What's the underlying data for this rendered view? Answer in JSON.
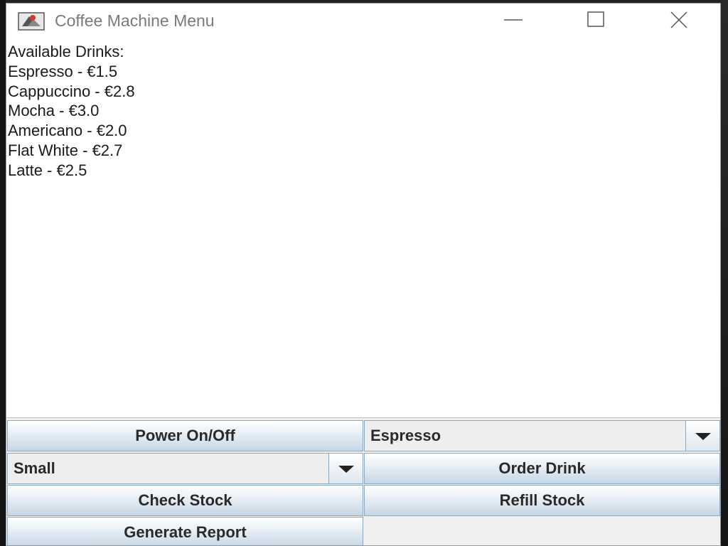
{
  "window": {
    "title": "Coffee Machine Menu"
  },
  "menu_text": {
    "heading": "Available Drinks:",
    "items": [
      "Espresso - €1.5",
      "Cappuccino - €2.8",
      "Mocha - €3.0",
      "Americano - €2.0",
      "Flat White - €2.7",
      "Latte - €2.5"
    ]
  },
  "controls": {
    "power_label": "Power On/Off",
    "drink_select_value": "Espresso",
    "size_select_value": "Small",
    "order_label": "Order Drink",
    "check_stock_label": "Check Stock",
    "refill_stock_label": "Refill Stock",
    "report_label": "Generate Report"
  },
  "icons": {
    "app": "coffee-app-icon",
    "minimize": "minimize-icon",
    "maximize": "maximize-icon",
    "close": "close-icon",
    "dropdown": "chevron-down-icon"
  },
  "colors": {
    "button_gradient_bottom": "#c6d6e4",
    "button_border": "#8fa6bb",
    "title_text": "#7a7a7a"
  }
}
